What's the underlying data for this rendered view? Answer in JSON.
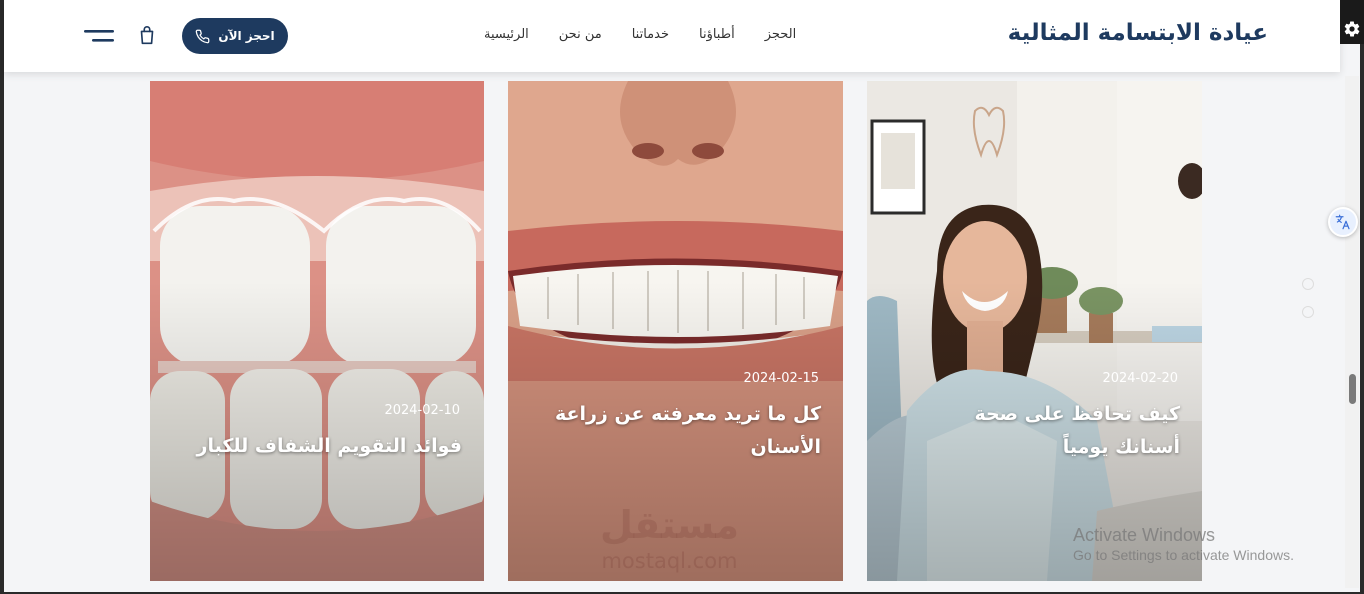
{
  "header": {
    "brand": "عيادة الابتسامة المثالية",
    "nav": [
      "الرئيسية",
      "من نحن",
      "خدماتنا",
      "أطباؤنا",
      "الحجز"
    ],
    "book_label": "احجز الآن"
  },
  "cards": [
    {
      "date": "2024-02-20",
      "title": "كيف تحافظ على صحة أسنانك يومياً"
    },
    {
      "date": "2024-02-15",
      "title": "كل ما تريد معرفته عن زراعة الأسنان"
    },
    {
      "date": "2024-02-10",
      "title": "فوائد التقويم الشفاف للكبار"
    }
  ],
  "watermark": {
    "ar": "مستقل",
    "en": "mostaql.com"
  },
  "os_notice": {
    "title": "Activate Windows",
    "subtitle": "Go to Settings to activate Windows."
  },
  "icons": {
    "phone": "phone-icon",
    "cart": "cart-icon",
    "menu": "menu-icon",
    "settings": "gear-icon",
    "translate": "translate-icon"
  },
  "colors": {
    "primary": "#1e3a5f",
    "header_bg": "#ffffff"
  }
}
